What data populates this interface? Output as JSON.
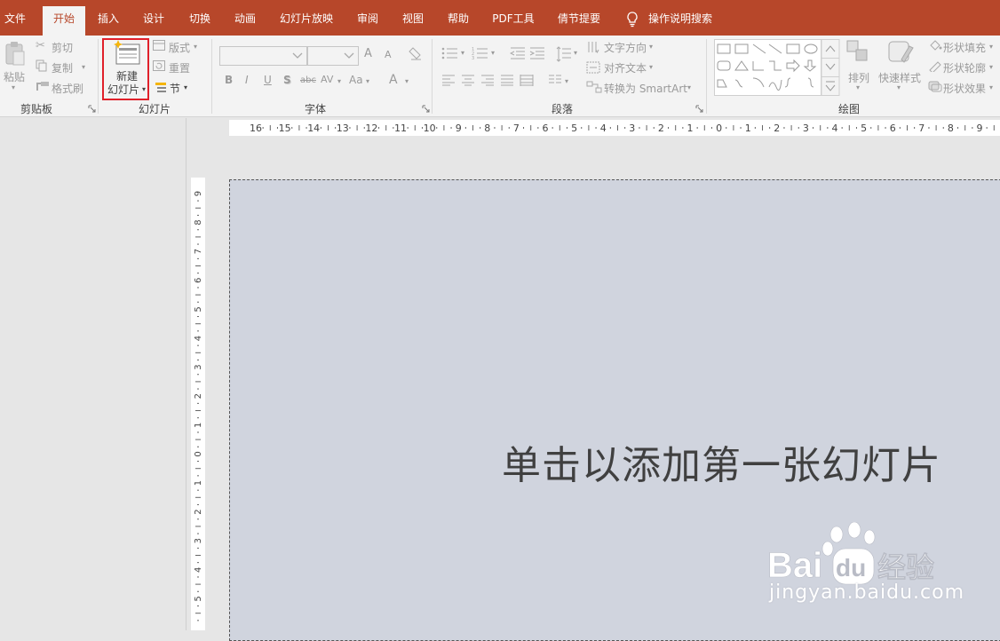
{
  "tabs": [
    "文件",
    "开始",
    "插入",
    "设计",
    "切换",
    "动画",
    "幻灯片放映",
    "审阅",
    "视图",
    "帮助",
    "PDF工具",
    "倩节提要"
  ],
  "active_tab": "开始",
  "tell_me": "操作说明搜索",
  "clipboard": {
    "paste": "粘贴",
    "cut": "剪切",
    "copy": "复制",
    "format_painter": "格式刷",
    "label": "剪贴板"
  },
  "slides": {
    "new_slide_line1": "新建",
    "new_slide_line2": "幻灯片",
    "layout": "版式",
    "reset": "重置",
    "section": "节",
    "label": "幻灯片"
  },
  "font": {
    "font_name": "",
    "font_size": "",
    "grow": "A",
    "shrink": "A",
    "bold": "B",
    "italic": "I",
    "underline": "U",
    "shadow": "S",
    "strike": "abc",
    "spacing": "AV",
    "case": "Aa",
    "color": "A",
    "label": "字体"
  },
  "paragraph": {
    "text_direction": "文字方向",
    "align_text": "对齐文本",
    "smartart": "转换为 SmartArt",
    "label": "段落"
  },
  "drawing": {
    "arrange": "排列",
    "quick_styles": "快速样式",
    "shape_fill": "形状填充",
    "shape_outline": "形状轮廓",
    "shape_effects": "形状效果",
    "label": "绘图"
  },
  "hruler_labels": [
    "16",
    "15",
    "14",
    "13",
    "12",
    "11",
    "10",
    "9",
    "8",
    "7",
    "6",
    "5",
    "4",
    "3",
    "2",
    "1",
    "0",
    "1",
    "2",
    "3",
    "4",
    "5",
    "6",
    "7",
    "8",
    "9"
  ],
  "vruler_labels": [
    "9",
    "8",
    "7",
    "6",
    "5",
    "4",
    "3",
    "2",
    "1",
    "0",
    "1",
    "2",
    "3",
    "4",
    "5"
  ],
  "slide": {
    "placeholder": "单击以添加第一张幻灯片"
  },
  "watermark": {
    "brand": "Bai",
    "brand2": "du",
    "brand_cn": "经验",
    "url": "jingyan.baidu.com"
  },
  "colors": {
    "accent": "#b7472a",
    "ribbon": "#f3f3f3",
    "slide_bg": "#d0d4de",
    "highlight": "#e0202a"
  }
}
